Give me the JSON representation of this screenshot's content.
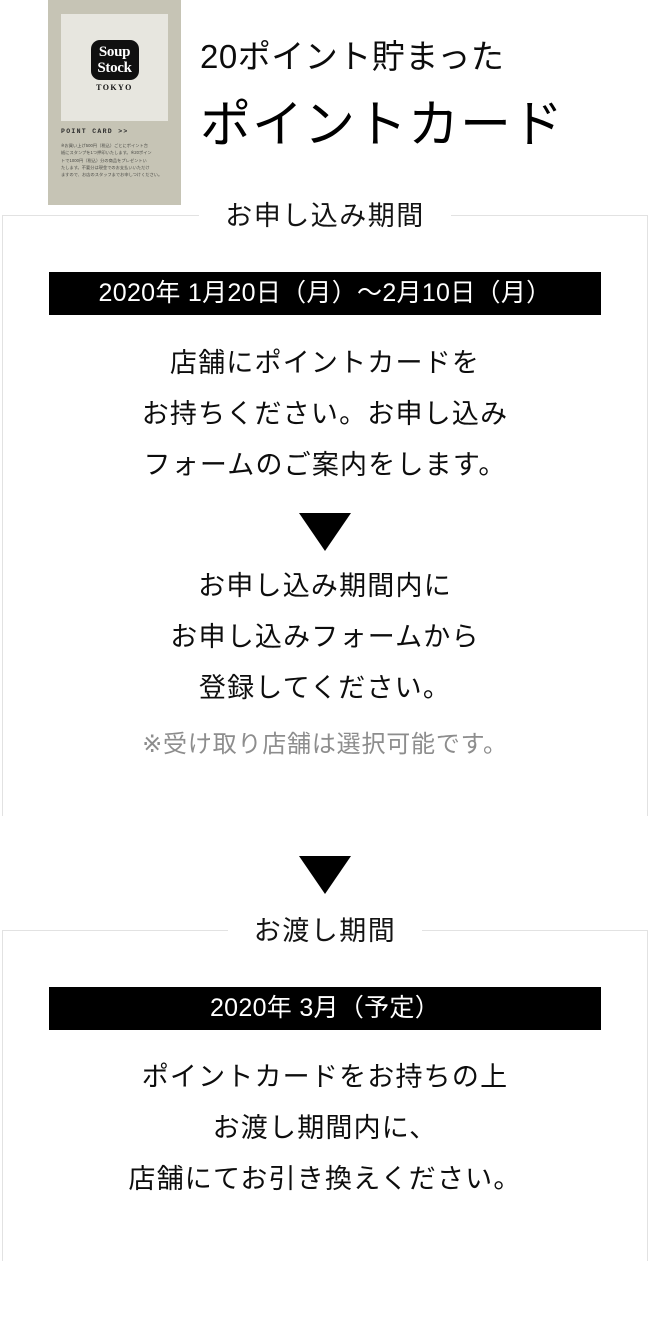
{
  "hero": {
    "card": {
      "logo_line1": "Soup",
      "logo_line2": "Stock",
      "logo_sub": "TOKYO",
      "caption_title": "POINT CARD  >>",
      "caption_lines": [
        "※お買い上げ500円（税込）ごとにポイント台",
        "紙にスタンプを1つ押印いたします。※20ポイン",
        "トで1000円（税込）分の商品をプレゼントい",
        "たします。不要分は現金でのお支払いいただけ",
        "ますので、お店のスタッフまでお申しつけください。"
      ]
    },
    "subtitle": "20ポイント貯まった",
    "title": "ポイントカード"
  },
  "section_application": {
    "legend": "お申し込み期間",
    "period_bar": "2020年 1月20日（月）～2月10日（月）",
    "step1_lines": [
      "店舗にポイントカードを",
      "お持ちください。お申し込み",
      "フォームのご案内をします。"
    ],
    "arrow_icon": "triangle-down-icon",
    "step2_lines": [
      "お申し込み期間内に",
      "お申し込みフォームから",
      "登録してください。"
    ],
    "note": "※受け取り店舗は選択可能です。"
  },
  "flow_arrow": {
    "icon": "triangle-down-icon"
  },
  "section_handover": {
    "legend": "お渡し期間",
    "period_bar": "2020年 3月（予定）",
    "body_lines": [
      "ポイントカードをお持ちの上",
      "お渡し期間内に、",
      "店舗にてお引き換えください。"
    ]
  },
  "colors": {
    "background": "#ffffff",
    "text": "#000000",
    "bar_background": "#000000",
    "bar_text": "#ffffff",
    "note_text": "#8d8d8d",
    "border": "#e2e2e2",
    "card_background": "#c6c4b5",
    "card_panel": "#e7e6df"
  }
}
